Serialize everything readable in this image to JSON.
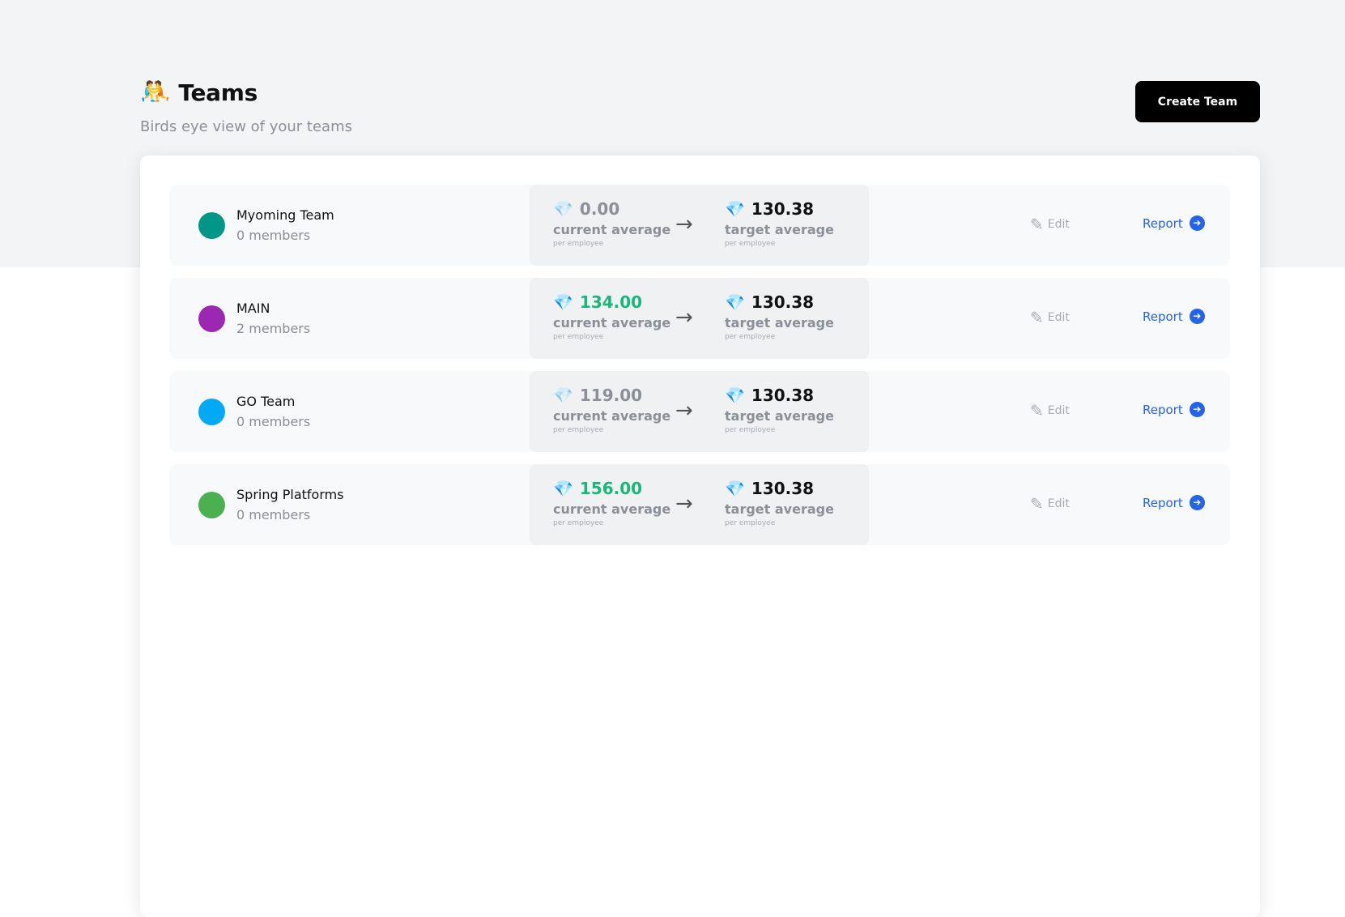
{
  "header": {
    "title_icon": "🤼",
    "title": "Teams",
    "subtitle": "Birds eye view of your teams",
    "create_label": "Create Team"
  },
  "icons": {
    "gem": "💎",
    "arrow": "→",
    "edit": "✎",
    "report": "➔"
  },
  "teams": [
    {
      "name": "Myoming Team",
      "members": "0 members",
      "color": "#009688",
      "current_value": "0.00",
      "current_label": "current average",
      "target_value": "130.38",
      "target_label": "target average",
      "per": "per employee",
      "edit_label": "Edit",
      "report_label": "Report"
    },
    {
      "name": "MAIN",
      "members": "2 members",
      "color": "#9c27b0",
      "current_value": "134.00",
      "current_label": "current average",
      "target_value": "130.38",
      "target_label": "target average",
      "per": "per employee",
      "edit_label": "Edit",
      "report_label": "Report"
    },
    {
      "name": "GO Team",
      "members": "0 members",
      "color": "#03a9f4",
      "current_value": "119.00",
      "current_label": "current average",
      "target_value": "130.38",
      "target_label": "target average",
      "per": "per employee",
      "edit_label": "Edit",
      "report_label": "Report"
    },
    {
      "name": "Spring Platforms",
      "members": "0 members",
      "color": "#4caf50",
      "current_value": "156.00",
      "current_label": "current average",
      "target_value": "130.38",
      "target_label": "target average",
      "per": "per employee",
      "edit_label": "Edit",
      "report_label": "Report"
    }
  ]
}
